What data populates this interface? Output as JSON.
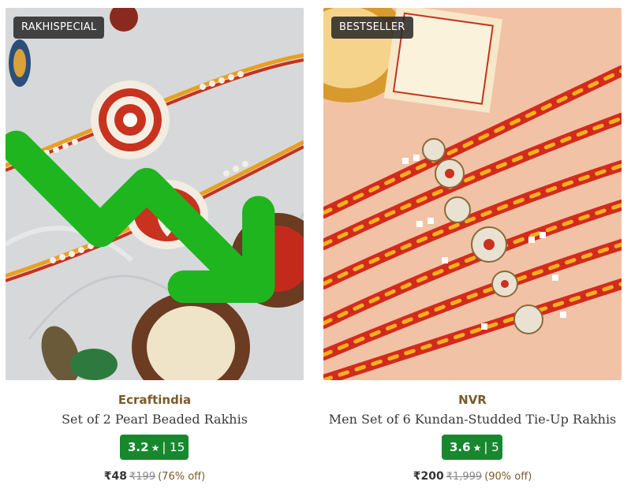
{
  "products": [
    {
      "badge": "RAKHISPECIAL",
      "brand": "Ecraftindia",
      "title": "Set of 2 Pearl Beaded Rakhis",
      "rating": "3.2",
      "reviews": "15",
      "price": "₹48",
      "mrp": "₹199",
      "discount": "(76% off)",
      "icons": [
        "trend-down-icon",
        "star-icon"
      ]
    },
    {
      "badge": "BESTSELLER",
      "brand": "NVR",
      "title": "Men Set of 6 Kundan-Studded Tie-Up Rakhis",
      "rating": "3.6",
      "reviews": "5",
      "price": "₹200",
      "mrp": "₹1,999",
      "discount": "(90% off)",
      "icons": [
        "star-icon"
      ]
    }
  ],
  "colors": {
    "rating_badge": "#17882e",
    "brand_text": "#7a5a2a",
    "product_badge": "#282828",
    "trend_icon": "#1fb51f"
  }
}
